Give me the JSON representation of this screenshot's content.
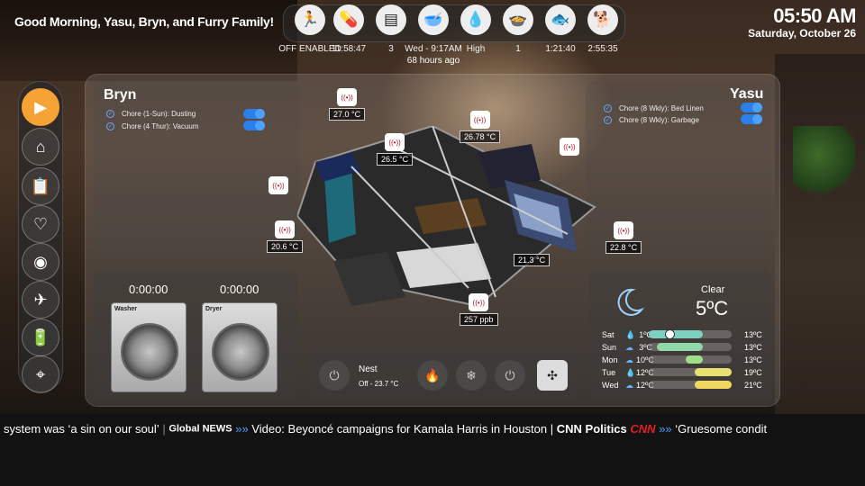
{
  "greeting": "Good Morning, Yasu, Bryn, and Furry Family!",
  "clock": {
    "time": "05:50 AM",
    "date": "Saturday, October 26"
  },
  "status_bar": [
    {
      "icon": "running-person-icon",
      "glyph": "🏃",
      "value": "OFF ENABLED",
      "sub": ""
    },
    {
      "icon": "medicine-bottle-icon",
      "glyph": "💊",
      "value": "11:58:47",
      "sub": ""
    },
    {
      "icon": "air-filter-icon",
      "glyph": "▤",
      "value": "3",
      "sub": ""
    },
    {
      "icon": "pet-bowl-food-icon",
      "glyph": "🥣",
      "value": "Wed - 9:17AM",
      "sub": "68 hours ago"
    },
    {
      "icon": "water-drop-icon",
      "glyph": "💧",
      "value": "High",
      "sub": ""
    },
    {
      "icon": "pet-food-bowl-icon",
      "glyph": "🍲",
      "value": "1",
      "sub": ""
    },
    {
      "icon": "fish-icon",
      "glyph": "🐟",
      "value": "1:21:40",
      "sub": ""
    },
    {
      "icon": "dog-icon",
      "glyph": "🐕",
      "value": "2:55:35",
      "sub": ""
    }
  ],
  "sidebar": [
    {
      "icon": "play-icon",
      "glyph": "▶"
    },
    {
      "icon": "home-cleaning-icon",
      "glyph": "⌂"
    },
    {
      "icon": "clipboard-add-icon",
      "glyph": "📋"
    },
    {
      "icon": "heart-pulse-icon",
      "glyph": "♡"
    },
    {
      "icon": "security-icon",
      "glyph": "◉"
    },
    {
      "icon": "airplane-icon",
      "glyph": "✈"
    },
    {
      "icon": "battery-charging-icon",
      "glyph": "🔋"
    },
    {
      "icon": "location-pin-icon",
      "glyph": "⌖"
    }
  ],
  "bryn": {
    "name": "Bryn",
    "chores": [
      "Chore (1-Sun): Dusting",
      "Chore (4 Thur): Vacuum"
    ]
  },
  "yasu": {
    "name": "Yasu",
    "chores": [
      "Chore (8 Wkly): Bed Linen",
      "Chore (8 Wkly): Garbage"
    ]
  },
  "sensors": [
    {
      "name": "sensor-bryn-room",
      "value": "27.0 °C"
    },
    {
      "name": "sensor-hallway",
      "value": "26.5 °C"
    },
    {
      "name": "sensor-kitchen",
      "value": "26.78 °C"
    },
    {
      "name": "sensor-bathroom",
      "value": ""
    },
    {
      "name": "sensor-office",
      "value": ""
    },
    {
      "name": "sensor-entry",
      "value": "20.6 °C"
    },
    {
      "name": "sensor-bedroom",
      "value": "22.8 °C"
    },
    {
      "name": "sensor-living",
      "value": "21.3 °C"
    },
    {
      "name": "sensor-air-quality",
      "value": "257 ppb"
    }
  ],
  "laundry": {
    "washer_time": "0:00:00",
    "dryer_time": "0:00:00",
    "washer_label": "Washer",
    "dryer_label": "Dryer"
  },
  "thermostat": {
    "name": "Nest",
    "status": "Off - 23.7 °C"
  },
  "weather": {
    "condition": "Clear",
    "temp": "5ºC",
    "forecast": [
      {
        "day": "Sat",
        "icon": "raindrop-icon",
        "glyph": "💧",
        "low": "1ºC",
        "high": "13ºC",
        "fill_start": 0.0,
        "fill_end": 0.65,
        "fill_color": "#7fd0c0",
        "marker": 0.25
      },
      {
        "day": "Sun",
        "icon": "partly-cloudy-icon",
        "glyph": "☁",
        "low": "3ºC",
        "high": "13ºC",
        "fill_start": 0.1,
        "fill_end": 0.65,
        "fill_color": "#8fd6a8"
      },
      {
        "day": "Mon",
        "icon": "cloud-icon",
        "glyph": "☁",
        "low": "10ºC",
        "high": "13ºC",
        "fill_start": 0.45,
        "fill_end": 0.65,
        "fill_color": "#9ee08a"
      },
      {
        "day": "Tue",
        "icon": "raindrop-icon",
        "glyph": "💧",
        "low": "12ºC",
        "high": "19ºC",
        "fill_start": 0.55,
        "fill_end": 1.0,
        "fill_color": "#e8e070"
      },
      {
        "day": "Wed",
        "icon": "cloud-icon",
        "glyph": "☁",
        "low": "12ºC",
        "high": "21ºC",
        "fill_start": 0.55,
        "fill_end": 1.0,
        "fill_color": "#f0d860"
      }
    ]
  },
  "ticker": {
    "headline1": "system was ‘a sin on our soul’",
    "source1": "Global NEWS",
    "headline2": "Video: Beyoncé campaigns for Kamala Harris in Houston",
    "source2": "CNN Politics",
    "source2_logo": "CNN",
    "headline3": "‘Gruesome condit"
  }
}
